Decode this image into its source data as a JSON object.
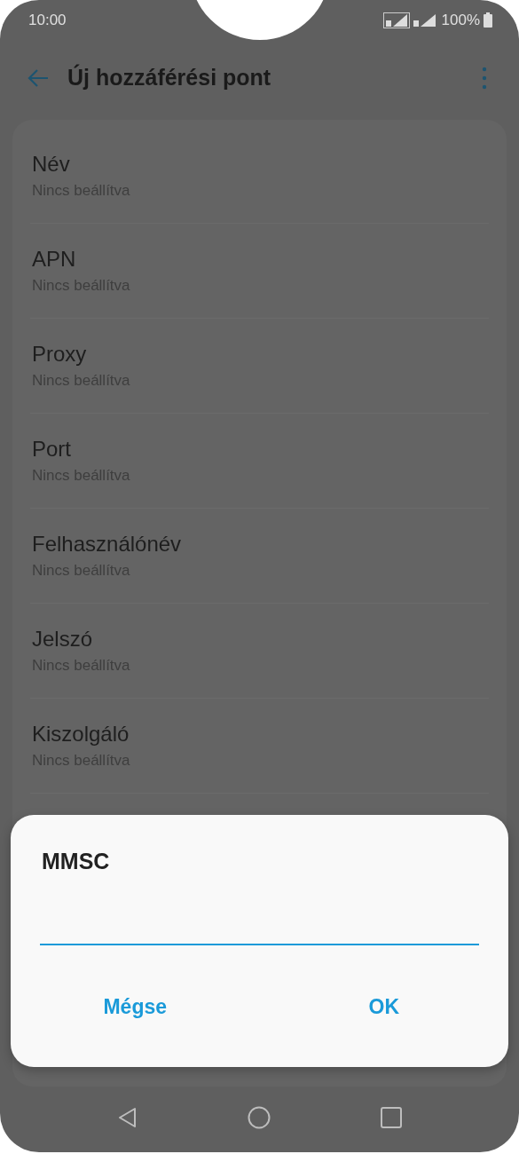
{
  "status_bar": {
    "time": "10:00",
    "battery": "100%"
  },
  "app_bar": {
    "title": "Új hozzáférési pont"
  },
  "settings": [
    {
      "title": "Név",
      "value": "Nincs beállítva"
    },
    {
      "title": "APN",
      "value": "Nincs beállítva"
    },
    {
      "title": "Proxy",
      "value": "Nincs beállítva"
    },
    {
      "title": "Port",
      "value": "Nincs beállítva"
    },
    {
      "title": "Felhasználónév",
      "value": "Nincs beállítva"
    },
    {
      "title": "Jelszó",
      "value": "Nincs beállítva"
    },
    {
      "title": "Kiszolgáló",
      "value": "Nincs beállítva"
    }
  ],
  "dialog": {
    "title": "MMSC",
    "buttons": [
      "Mégse",
      "OK"
    ]
  }
}
